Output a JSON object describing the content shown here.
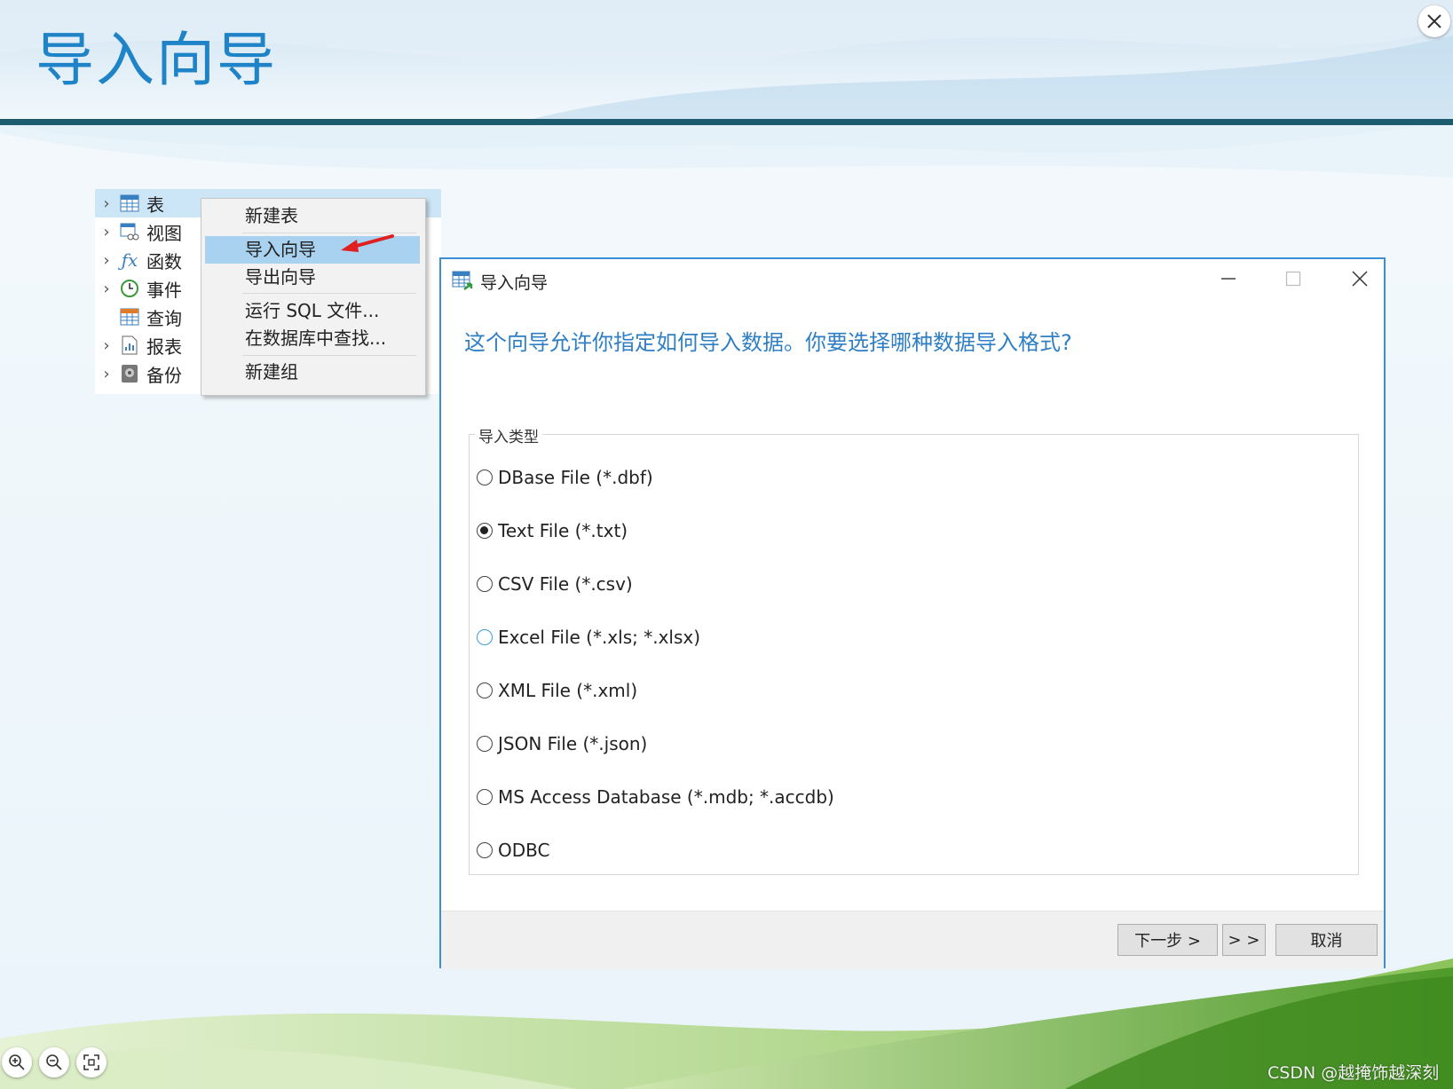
{
  "slide": {
    "title": "导入向导"
  },
  "tree": {
    "items": [
      {
        "label": "表",
        "icon": "table-icon",
        "chevron": true,
        "selected": true
      },
      {
        "label": "视图",
        "icon": "view-icon",
        "chevron": true
      },
      {
        "label": "函数",
        "icon": "function-icon",
        "chevron": true
      },
      {
        "label": "事件",
        "icon": "event-clock-icon",
        "chevron": true
      },
      {
        "label": "查询",
        "icon": "query-icon",
        "chevron": false
      },
      {
        "label": "报表",
        "icon": "report-icon",
        "chevron": true
      },
      {
        "label": "备份",
        "icon": "backup-icon",
        "chevron": true
      }
    ]
  },
  "context_menu": {
    "items": [
      {
        "label": "新建表"
      },
      {
        "label": "导入向导",
        "highlighted": true
      },
      {
        "label": "导出向导"
      },
      {
        "label": "运行 SQL 文件..."
      },
      {
        "label": "在数据库中查找..."
      },
      {
        "label": "新建组"
      }
    ]
  },
  "dialog": {
    "title": "导入向导",
    "question": "这个向导允许你指定如何导入数据。你要选择哪种数据导入格式?",
    "group_label": "导入类型",
    "options": [
      {
        "label": "DBase File (*.dbf)",
        "checked": false
      },
      {
        "label": "Text File (*.txt)",
        "checked": true
      },
      {
        "label": "CSV File (*.csv)",
        "checked": false
      },
      {
        "label": "Excel File (*.xls; *.xlsx)",
        "checked": false,
        "hover": true
      },
      {
        "label": "XML File (*.xml)",
        "checked": false
      },
      {
        "label": "JSON File (*.json)",
        "checked": false
      },
      {
        "label": "MS Access Database (*.mdb; *.accdb)",
        "checked": false
      },
      {
        "label": "ODBC",
        "checked": false
      }
    ],
    "buttons": {
      "next": "下一步 >",
      "last": "> >",
      "cancel": "取消"
    }
  },
  "watermark": "CSDN @越掩饰越深刻",
  "colors": {
    "title_blue": "#1f83c7",
    "rule_teal": "#1c5c6e",
    "dialog_border": "#3b8fd4",
    "menu_highlight": "#a9d1f0",
    "arrow_red": "#e02020",
    "grass_green": "#6db33f"
  }
}
